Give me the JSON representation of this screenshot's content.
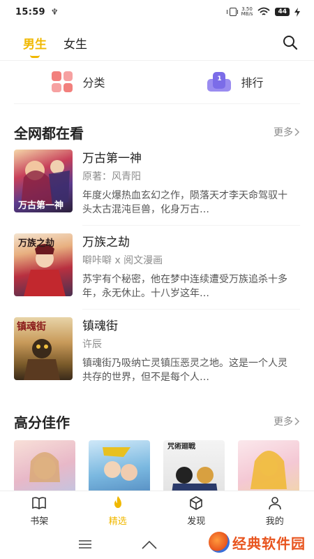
{
  "status": {
    "time": "15:59",
    "usb": "♆",
    "speed_value": "3.50",
    "speed_unit": "MB/s",
    "battery": "44"
  },
  "tabs": [
    {
      "label": "男生",
      "active": true
    },
    {
      "label": "女生",
      "active": false
    }
  ],
  "shortcuts": {
    "category": "分类",
    "ranking": "排行",
    "ranking_badge": "1"
  },
  "section1": {
    "title": "全网都在看",
    "more": "更多",
    "books": [
      {
        "title": "万古第一神",
        "author": "原著：风青阳",
        "desc": "年度火爆热血玄幻之作，陨落天才李天命驾驭十头太古混沌巨兽，化身万古…",
        "cover_text": "万古第一神"
      },
      {
        "title": "万族之劫",
        "author": "噼咔噼 x 阅文漫画",
        "desc": "苏宇有个秘密，他在梦中连续遭受万族追杀十多年，永无休止。十八岁这年…",
        "cover_text": "万族之劫"
      },
      {
        "title": "镇魂街",
        "author": "许辰",
        "desc": "镇魂街乃吸纳亡灵镇压恶灵之地。这是一个人灵共存的世界，但不是每个人…",
        "cover_text": "镇魂街"
      }
    ]
  },
  "section2": {
    "title": "高分佳作",
    "more": "更多",
    "cover_texts": [
      "",
      "",
      "",
      ""
    ],
    "third_cover_title": "咒術廻戦"
  },
  "bottom_nav": [
    {
      "label": "书架",
      "icon": "book-icon",
      "active": false
    },
    {
      "label": "精选",
      "icon": "flame-icon",
      "active": true
    },
    {
      "label": "发现",
      "icon": "cube-icon",
      "active": false
    },
    {
      "label": "我的",
      "icon": "person-icon",
      "active": false
    }
  ],
  "watermark": "经典软件园",
  "colors": {
    "accent": "#f0b800",
    "category_icon": "#f06a66",
    "ranking_icon": "#7b6ce8"
  }
}
